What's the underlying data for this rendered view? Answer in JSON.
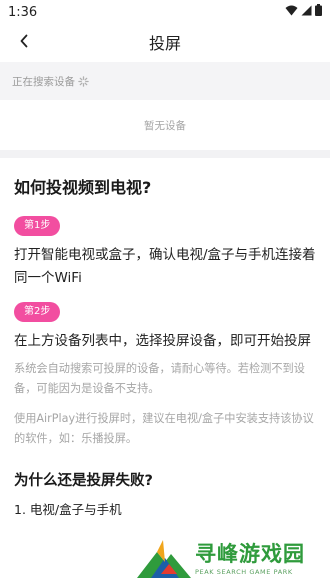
{
  "status_bar": {
    "time": "1:36",
    "icons": [
      "wifi-icon",
      "signal-icon",
      "battery-icon"
    ]
  },
  "app_bar": {
    "title": "投屏",
    "back_icon": "chevron-left-icon"
  },
  "scan": {
    "label": "正在搜索设备",
    "empty_text": "暂无设备"
  },
  "help": {
    "title": "如何投视频到电视?",
    "step1": {
      "badge": "第1步",
      "text": "打开智能电视或盒子，确认电视/盒子与手机连接着同一个WiFi"
    },
    "step2": {
      "badge": "第2步",
      "text": "在上方设备列表中，选择投屏设备，即可开始投屏"
    },
    "note1": "系统会自动搜索可投屏的设备，请耐心等待。若检测不到设备，可能因为是设备不支持。",
    "note2": "使用AirPlay进行投屏时，建议在电视/盒子中安装支持该协议的软件，如：乐播投屏。"
  },
  "section2": {
    "title": "为什么还是投屏失败?",
    "reason1": "1. 电视/盒子与手机"
  },
  "watermark": {
    "cn": "寻峰游戏园",
    "en": "PEAK SEARCH GAME PARK"
  },
  "colors": {
    "accent": "#f24ea0",
    "brand_green": "#2f9b3c"
  }
}
